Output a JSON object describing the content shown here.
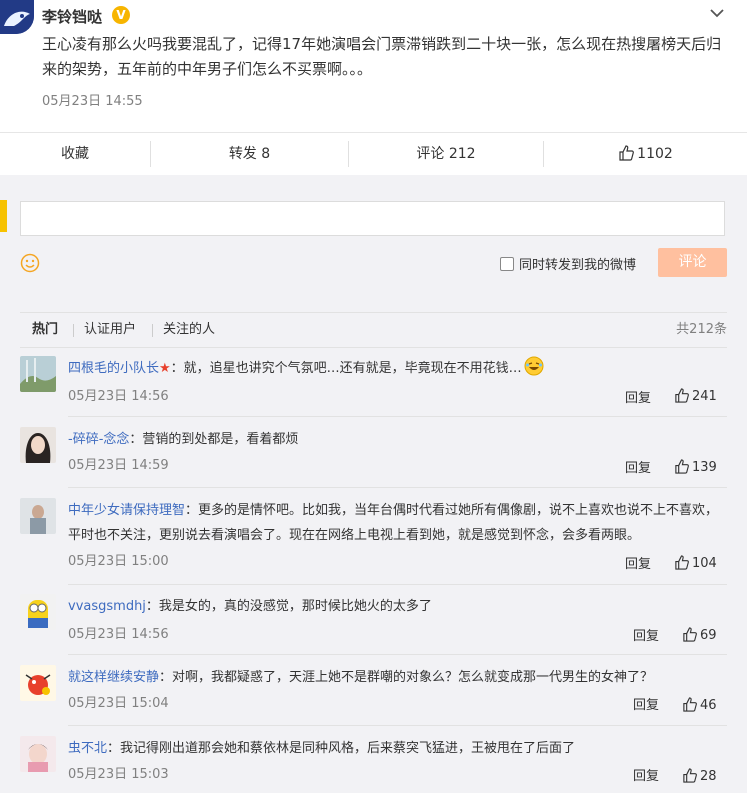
{
  "post": {
    "author": "李铃铛哒",
    "verified_badge": "V",
    "text": "王心凌有那么火吗我要混乱了，记得17年她演唱会门票滞销跌到二十块一张，怎么现在热搜屠榜天后归来的架势，五年前的中年男子们怎么不买票啊。。。",
    "time": "05月23日 14:55"
  },
  "actions": {
    "collect": "收藏",
    "repost": "转发 8",
    "comment": "评论 212",
    "like": "1102"
  },
  "composer": {
    "forward_label": "同时转发到我的微博",
    "submit_label": "评论"
  },
  "filters": {
    "hot": "热门",
    "verified": "认证用户",
    "following": "关注的人",
    "total": "共212条"
  },
  "comments": [
    {
      "user": "四根毛的小队长",
      "text": "：就，追星也讲究个气氛吧…还有就是，毕竟现在不用花钱…",
      "time": "05月23日 14:56",
      "reply": "回复",
      "likes": "241"
    },
    {
      "user": "-碎碎-念念",
      "text": "：营销的到处都是，看着都烦",
      "time": "05月23日 14:59",
      "reply": "回复",
      "likes": "139"
    },
    {
      "user": "中年少女请保持理智",
      "text": "：更多的是情怀吧。比如我，当年台偶时代看过她所有偶像剧，说不上喜欢也说不上不喜欢，平时也不关注，更别说去看演唱会了。现在在网络上电视上看到她，就是感觉到怀念，会多看两眼。",
      "time": "05月23日 15:00",
      "reply": "回复",
      "likes": "104"
    },
    {
      "user": "vvasgsmdhj",
      "text": "：我是女的，真的没感觉，那时候比她火的太多了",
      "time": "05月23日 14:56",
      "reply": "回复",
      "likes": "69"
    },
    {
      "user": "就这样继续安静",
      "text": "：对啊，我都疑惑了，天涯上她不是群嘲的对象么？怎么就变成那一代男生的女神了？",
      "time": "05月23日 15:04",
      "reply": "回复",
      "likes": "46"
    },
    {
      "user": "虫不北",
      "text": "：我记得刚出道那会她和蔡依林是同种风格，后来蔡突飞猛进，王被甩在了后面了",
      "time": "05月23日 15:03",
      "reply": "回复",
      "likes": "28"
    }
  ]
}
